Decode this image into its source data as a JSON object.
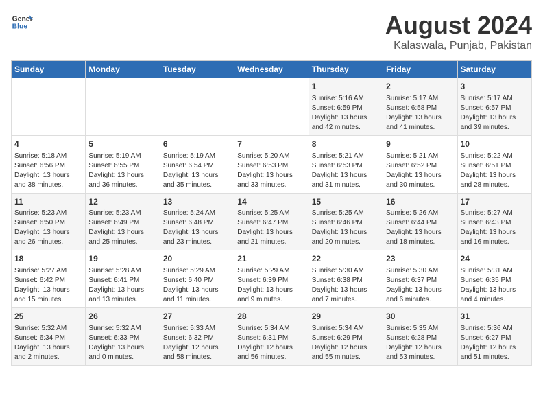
{
  "header": {
    "logo_general": "General",
    "logo_blue": "Blue",
    "main_title": "August 2024",
    "subtitle": "Kalaswala, Punjab, Pakistan"
  },
  "calendar": {
    "days_of_week": [
      "Sunday",
      "Monday",
      "Tuesday",
      "Wednesday",
      "Thursday",
      "Friday",
      "Saturday"
    ],
    "weeks": [
      [
        {
          "day": "",
          "info": ""
        },
        {
          "day": "",
          "info": ""
        },
        {
          "day": "",
          "info": ""
        },
        {
          "day": "",
          "info": ""
        },
        {
          "day": "1",
          "info": "Sunrise: 5:16 AM\nSunset: 6:59 PM\nDaylight: 13 hours\nand 42 minutes."
        },
        {
          "day": "2",
          "info": "Sunrise: 5:17 AM\nSunset: 6:58 PM\nDaylight: 13 hours\nand 41 minutes."
        },
        {
          "day": "3",
          "info": "Sunrise: 5:17 AM\nSunset: 6:57 PM\nDaylight: 13 hours\nand 39 minutes."
        }
      ],
      [
        {
          "day": "4",
          "info": "Sunrise: 5:18 AM\nSunset: 6:56 PM\nDaylight: 13 hours\nand 38 minutes."
        },
        {
          "day": "5",
          "info": "Sunrise: 5:19 AM\nSunset: 6:55 PM\nDaylight: 13 hours\nand 36 minutes."
        },
        {
          "day": "6",
          "info": "Sunrise: 5:19 AM\nSunset: 6:54 PM\nDaylight: 13 hours\nand 35 minutes."
        },
        {
          "day": "7",
          "info": "Sunrise: 5:20 AM\nSunset: 6:53 PM\nDaylight: 13 hours\nand 33 minutes."
        },
        {
          "day": "8",
          "info": "Sunrise: 5:21 AM\nSunset: 6:53 PM\nDaylight: 13 hours\nand 31 minutes."
        },
        {
          "day": "9",
          "info": "Sunrise: 5:21 AM\nSunset: 6:52 PM\nDaylight: 13 hours\nand 30 minutes."
        },
        {
          "day": "10",
          "info": "Sunrise: 5:22 AM\nSunset: 6:51 PM\nDaylight: 13 hours\nand 28 minutes."
        }
      ],
      [
        {
          "day": "11",
          "info": "Sunrise: 5:23 AM\nSunset: 6:50 PM\nDaylight: 13 hours\nand 26 minutes."
        },
        {
          "day": "12",
          "info": "Sunrise: 5:23 AM\nSunset: 6:49 PM\nDaylight: 13 hours\nand 25 minutes."
        },
        {
          "day": "13",
          "info": "Sunrise: 5:24 AM\nSunset: 6:48 PM\nDaylight: 13 hours\nand 23 minutes."
        },
        {
          "day": "14",
          "info": "Sunrise: 5:25 AM\nSunset: 6:47 PM\nDaylight: 13 hours\nand 21 minutes."
        },
        {
          "day": "15",
          "info": "Sunrise: 5:25 AM\nSunset: 6:46 PM\nDaylight: 13 hours\nand 20 minutes."
        },
        {
          "day": "16",
          "info": "Sunrise: 5:26 AM\nSunset: 6:44 PM\nDaylight: 13 hours\nand 18 minutes."
        },
        {
          "day": "17",
          "info": "Sunrise: 5:27 AM\nSunset: 6:43 PM\nDaylight: 13 hours\nand 16 minutes."
        }
      ],
      [
        {
          "day": "18",
          "info": "Sunrise: 5:27 AM\nSunset: 6:42 PM\nDaylight: 13 hours\nand 15 minutes."
        },
        {
          "day": "19",
          "info": "Sunrise: 5:28 AM\nSunset: 6:41 PM\nDaylight: 13 hours\nand 13 minutes."
        },
        {
          "day": "20",
          "info": "Sunrise: 5:29 AM\nSunset: 6:40 PM\nDaylight: 13 hours\nand 11 minutes."
        },
        {
          "day": "21",
          "info": "Sunrise: 5:29 AM\nSunset: 6:39 PM\nDaylight: 13 hours\nand 9 minutes."
        },
        {
          "day": "22",
          "info": "Sunrise: 5:30 AM\nSunset: 6:38 PM\nDaylight: 13 hours\nand 7 minutes."
        },
        {
          "day": "23",
          "info": "Sunrise: 5:30 AM\nSunset: 6:37 PM\nDaylight: 13 hours\nand 6 minutes."
        },
        {
          "day": "24",
          "info": "Sunrise: 5:31 AM\nSunset: 6:35 PM\nDaylight: 13 hours\nand 4 minutes."
        }
      ],
      [
        {
          "day": "25",
          "info": "Sunrise: 5:32 AM\nSunset: 6:34 PM\nDaylight: 13 hours\nand 2 minutes."
        },
        {
          "day": "26",
          "info": "Sunrise: 5:32 AM\nSunset: 6:33 PM\nDaylight: 13 hours\nand 0 minutes."
        },
        {
          "day": "27",
          "info": "Sunrise: 5:33 AM\nSunset: 6:32 PM\nDaylight: 12 hours\nand 58 minutes."
        },
        {
          "day": "28",
          "info": "Sunrise: 5:34 AM\nSunset: 6:31 PM\nDaylight: 12 hours\nand 56 minutes."
        },
        {
          "day": "29",
          "info": "Sunrise: 5:34 AM\nSunset: 6:29 PM\nDaylight: 12 hours\nand 55 minutes."
        },
        {
          "day": "30",
          "info": "Sunrise: 5:35 AM\nSunset: 6:28 PM\nDaylight: 12 hours\nand 53 minutes."
        },
        {
          "day": "31",
          "info": "Sunrise: 5:36 AM\nSunset: 6:27 PM\nDaylight: 12 hours\nand 51 minutes."
        }
      ]
    ]
  }
}
